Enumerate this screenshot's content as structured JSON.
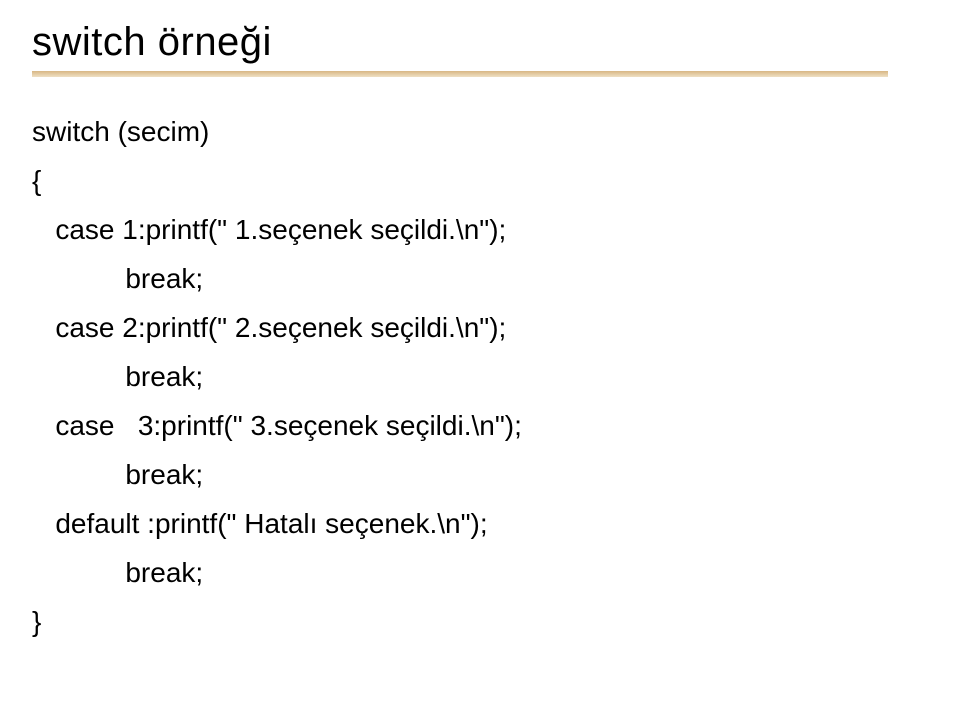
{
  "slide": {
    "title": "switch örneği",
    "code": "switch (secim)\n{\n   case 1:printf(\" 1.seçenek seçildi.\\n\");\n            break;\n   case 2:printf(\" 2.seçenek seçildi.\\n\");\n            break;\n   case   3:printf(\" 3.seçenek seçildi.\\n\");\n            break;\n   default :printf(\" Hatalı seçenek.\\n\");\n            break;\n}"
  }
}
